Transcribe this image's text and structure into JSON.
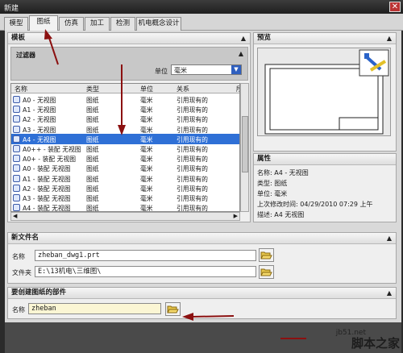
{
  "window": {
    "title": "新建",
    "close_glyph": "✕"
  },
  "tabs": [
    {
      "label": "模型",
      "active": false
    },
    {
      "label": "图纸",
      "active": true
    },
    {
      "label": "仿真",
      "active": false
    },
    {
      "label": "加工",
      "active": false
    },
    {
      "label": "检测",
      "active": false
    },
    {
      "label": "机电概念设计",
      "active": false
    }
  ],
  "template": {
    "title": "模板",
    "filter": {
      "title": "过滤器",
      "unit_label": "单位",
      "unit_value": "毫米"
    },
    "columns": [
      "名称",
      "类型",
      "单位",
      "关系",
      "所"
    ],
    "rows": [
      {
        "name": "A0 - 无视图",
        "type": "图纸",
        "unit": "毫米",
        "rel": "引用现有的",
        "selected": false
      },
      {
        "name": "A1 - 无视图",
        "type": "图纸",
        "unit": "毫米",
        "rel": "引用现有的",
        "selected": false
      },
      {
        "name": "A2 - 无视图",
        "type": "图纸",
        "unit": "毫米",
        "rel": "引用现有的",
        "selected": false
      },
      {
        "name": "A3 - 无视图",
        "type": "图纸",
        "unit": "毫米",
        "rel": "引用现有的",
        "selected": false
      },
      {
        "name": "A4 - 无视图",
        "type": "图纸",
        "unit": "毫米",
        "rel": "引用现有的",
        "selected": true
      },
      {
        "name": "A0++ - 装配 无视图",
        "type": "图纸",
        "unit": "毫米",
        "rel": "引用现有的",
        "selected": false
      },
      {
        "name": "A0+ - 装配 无视图",
        "type": "图纸",
        "unit": "毫米",
        "rel": "引用现有的",
        "selected": false
      },
      {
        "name": "A0 - 装配 无视图",
        "type": "图纸",
        "unit": "毫米",
        "rel": "引用现有的",
        "selected": false
      },
      {
        "name": "A1 - 装配 无视图",
        "type": "图纸",
        "unit": "毫米",
        "rel": "引用现有的",
        "selected": false
      },
      {
        "name": "A2 - 装配 无视图",
        "type": "图纸",
        "unit": "毫米",
        "rel": "引用现有的",
        "selected": false
      },
      {
        "name": "A3 - 装配 无视图",
        "type": "图纸",
        "unit": "毫米",
        "rel": "引用现有的",
        "selected": false
      },
      {
        "name": "A4 - 装配 无视图",
        "type": "图纸",
        "unit": "毫米",
        "rel": "引用现有的",
        "selected": false
      }
    ]
  },
  "preview": {
    "title": "预览"
  },
  "properties": {
    "title": "属性",
    "items": [
      {
        "label": "名称:",
        "value": "A4 - 无视图"
      },
      {
        "label": "类型:",
        "value": "图纸"
      },
      {
        "label": "单位:",
        "value": "毫米"
      },
      {
        "label": "上次修改时间:",
        "value": "04/29/2010 07:29 上午"
      },
      {
        "label": "描述:",
        "value": "A4 无视图"
      }
    ]
  },
  "new_file": {
    "title": "新文件名",
    "name_label": "名称",
    "name_value": "zheban_dwg1.prt",
    "folder_label": "文件夹",
    "folder_value": "E:\\13机电\\三维图\\"
  },
  "part": {
    "title": "要创建图纸的部件",
    "name_label": "名称",
    "name_value": "zheban"
  },
  "watermark": {
    "site": "jb51.net",
    "brand": "脚本之家"
  },
  "colors": {
    "accent_arrow": "#8b1010",
    "selection": "#2f70d6"
  }
}
